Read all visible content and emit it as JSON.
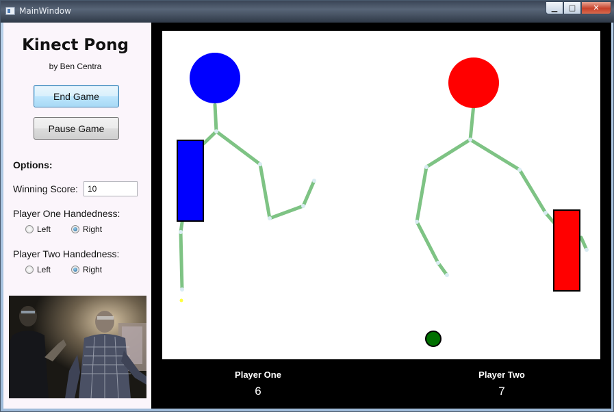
{
  "window": {
    "title": "MainWindow"
  },
  "window_controls": {
    "minimize": "▁",
    "maximize": "□",
    "close": "✕"
  },
  "app": {
    "title": "Kinect Pong",
    "author": "by Ben Centra"
  },
  "buttons": {
    "end_game": "End Game",
    "pause_game": "Pause Game"
  },
  "options": {
    "heading": "Options:",
    "winning_score_label": "Winning Score:",
    "winning_score_value": "10",
    "player_one_handedness_label": "Player One Handedness:",
    "player_two_handedness_label": "Player Two Handedness:",
    "left_label": "Left",
    "right_label": "Right",
    "player_one_handedness": "Right",
    "player_two_handedness": "Right"
  },
  "scores": {
    "player_one_label": "Player One",
    "player_one_score": "6",
    "player_two_label": "Player Two",
    "player_two_score": "7"
  },
  "colors": {
    "player_one": "#0000ff",
    "player_two": "#ff0000",
    "ball": "#007000",
    "skeleton": "#7ec384"
  }
}
